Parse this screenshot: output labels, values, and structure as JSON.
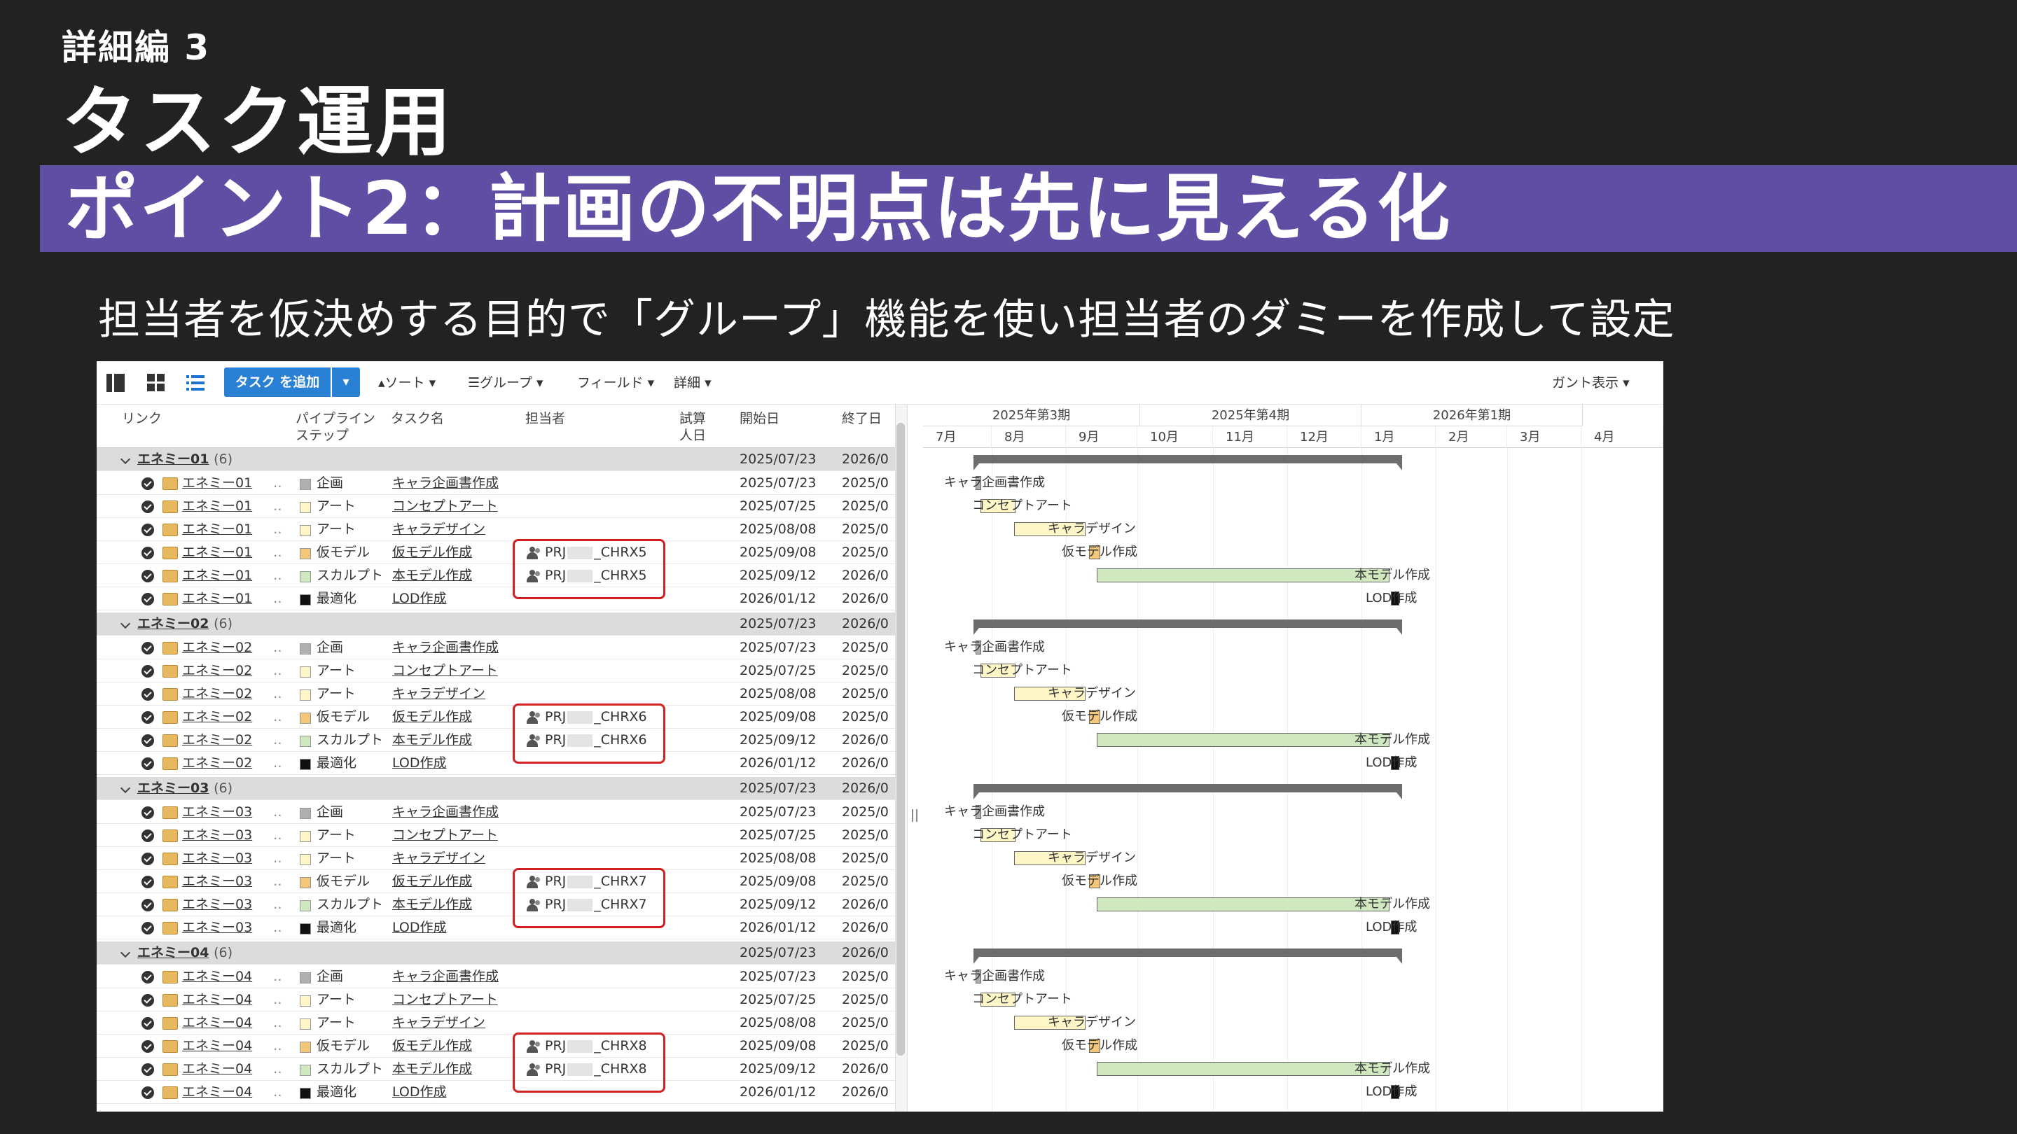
{
  "slide": {
    "eyebrow": "詳細編 3",
    "title": "タスク運用",
    "point": "ポイント2：計画の不明点は先に見える化",
    "subtitle": "担当者を仮決めする目的で「グループ」機能を使い担当者のダミーを作成して設定"
  },
  "toolbar": {
    "add_task": "タスク を追加",
    "sort": "ソート",
    "group": "グループ",
    "field": "フィールド",
    "detail": "詳細",
    "gantt_view": "ガント表示"
  },
  "columns": {
    "link": "リンク",
    "pipeline": "パイプライン ステップ",
    "task_name": "タスク名",
    "assignee": "担当者",
    "estimate": "試算 人日",
    "start": "開始日",
    "end": "終了日"
  },
  "gantt_header": {
    "quarters": [
      "2025年第3期",
      "2025年第4期",
      "2026年第1期"
    ],
    "months": [
      "7月",
      "8月",
      "9月",
      "10月",
      "11月",
      "12月",
      "1月",
      "2月",
      "3月",
      "4月"
    ]
  },
  "groups": [
    {
      "name": "エネミー01",
      "count": "(6)",
      "start": "2025/07/23",
      "end": "2026/0",
      "tasks": [
        {
          "link": "エネミー01",
          "step": "企画",
          "color": "#b0b0b0",
          "task": "キャラ企画書作成",
          "assignee": "",
          "start": "2025/07/23",
          "end": "2025/0"
        },
        {
          "link": "エネミー01",
          "step": "アート",
          "color": "#fff6c8",
          "task": "コンセプトアート",
          "assignee": "",
          "start": "2025/07/25",
          "end": "2025/0"
        },
        {
          "link": "エネミー01",
          "step": "アート",
          "color": "#fff6c8",
          "task": "キャラデザイン",
          "assignee": "",
          "start": "2025/08/08",
          "end": "2025/0"
        },
        {
          "link": "エネミー01",
          "step": "仮モデル",
          "color": "#f2c77a",
          "task": "仮モデル作成",
          "assignee_prefix": "PRJ",
          "assignee_suffix": "_CHRX5",
          "start": "2025/09/08",
          "end": "2025/0"
        },
        {
          "link": "エネミー01",
          "step": "スカルプト",
          "color": "#cfe8c0",
          "task": "本モデル作成",
          "assignee_prefix": "PRJ",
          "assignee_suffix": "_CHRX5",
          "start": "2025/09/12",
          "end": "2026/0"
        },
        {
          "link": "エネミー01",
          "step": "最適化",
          "color": "#111111",
          "task": "LOD作成",
          "assignee": "",
          "start": "2026/01/12",
          "end": "2026/0"
        }
      ]
    },
    {
      "name": "エネミー02",
      "count": "(6)",
      "start": "2025/07/23",
      "end": "2026/0",
      "tasks": [
        {
          "link": "エネミー02",
          "step": "企画",
          "color": "#b0b0b0",
          "task": "キャラ企画書作成",
          "assignee": "",
          "start": "2025/07/23",
          "end": "2025/0"
        },
        {
          "link": "エネミー02",
          "step": "アート",
          "color": "#fff6c8",
          "task": "コンセプトアート",
          "assignee": "",
          "start": "2025/07/25",
          "end": "2025/0"
        },
        {
          "link": "エネミー02",
          "step": "アート",
          "color": "#fff6c8",
          "task": "キャラデザイン",
          "assignee": "",
          "start": "2025/08/08",
          "end": "2025/0"
        },
        {
          "link": "エネミー02",
          "step": "仮モデル",
          "color": "#f2c77a",
          "task": "仮モデル作成",
          "assignee_prefix": "PRJ",
          "assignee_suffix": "_CHRX6",
          "start": "2025/09/08",
          "end": "2025/0"
        },
        {
          "link": "エネミー02",
          "step": "スカルプト",
          "color": "#cfe8c0",
          "task": "本モデル作成",
          "assignee_prefix": "PRJ",
          "assignee_suffix": "_CHRX6",
          "start": "2025/09/12",
          "end": "2026/0"
        },
        {
          "link": "エネミー02",
          "step": "最適化",
          "color": "#111111",
          "task": "LOD作成",
          "assignee": "",
          "start": "2026/01/12",
          "end": "2026/0"
        }
      ]
    },
    {
      "name": "エネミー03",
      "count": "(6)",
      "start": "2025/07/23",
      "end": "2026/0",
      "tasks": [
        {
          "link": "エネミー03",
          "step": "企画",
          "color": "#b0b0b0",
          "task": "キャラ企画書作成",
          "assignee": "",
          "start": "2025/07/23",
          "end": "2025/0"
        },
        {
          "link": "エネミー03",
          "step": "アート",
          "color": "#fff6c8",
          "task": "コンセプトアート",
          "assignee": "",
          "start": "2025/07/25",
          "end": "2025/0"
        },
        {
          "link": "エネミー03",
          "step": "アート",
          "color": "#fff6c8",
          "task": "キャラデザイン",
          "assignee": "",
          "start": "2025/08/08",
          "end": "2025/0"
        },
        {
          "link": "エネミー03",
          "step": "仮モデル",
          "color": "#f2c77a",
          "task": "仮モデル作成",
          "assignee_prefix": "PRJ",
          "assignee_suffix": "_CHRX7",
          "start": "2025/09/08",
          "end": "2025/0"
        },
        {
          "link": "エネミー03",
          "step": "スカルプト",
          "color": "#cfe8c0",
          "task": "本モデル作成",
          "assignee_prefix": "PRJ",
          "assignee_suffix": "_CHRX7",
          "start": "2025/09/12",
          "end": "2026/0"
        },
        {
          "link": "エネミー03",
          "step": "最適化",
          "color": "#111111",
          "task": "LOD作成",
          "assignee": "",
          "start": "2026/01/12",
          "end": "2026/0"
        }
      ]
    },
    {
      "name": "エネミー04",
      "count": "(6)",
      "start": "2025/07/23",
      "end": "2026/0",
      "tasks": [
        {
          "link": "エネミー04",
          "step": "企画",
          "color": "#b0b0b0",
          "task": "キャラ企画書作成",
          "assignee": "",
          "start": "2025/07/23",
          "end": "2025/0"
        },
        {
          "link": "エネミー04",
          "step": "アート",
          "color": "#fff6c8",
          "task": "コンセプトアート",
          "assignee": "",
          "start": "2025/07/25",
          "end": "2025/0"
        },
        {
          "link": "エネミー04",
          "step": "アート",
          "color": "#fff6c8",
          "task": "キャラデザイン",
          "assignee": "",
          "start": "2025/08/08",
          "end": "2025/0"
        },
        {
          "link": "エネミー04",
          "step": "仮モデル",
          "color": "#f2c77a",
          "task": "仮モデル作成",
          "assignee_prefix": "PRJ",
          "assignee_suffix": "_CHRX8",
          "start": "2025/09/08",
          "end": "2025/0"
        },
        {
          "link": "エネミー04",
          "step": "スカルプト",
          "color": "#cfe8c0",
          "task": "本モデル作成",
          "assignee_prefix": "PRJ",
          "assignee_suffix": "_CHRX8",
          "start": "2025/09/12",
          "end": "2026/0"
        },
        {
          "link": "エネミー04",
          "step": "最適化",
          "color": "#111111",
          "task": "LOD作成",
          "assignee": "",
          "start": "2026/01/12",
          "end": "2026/0"
        }
      ]
    }
  ]
}
